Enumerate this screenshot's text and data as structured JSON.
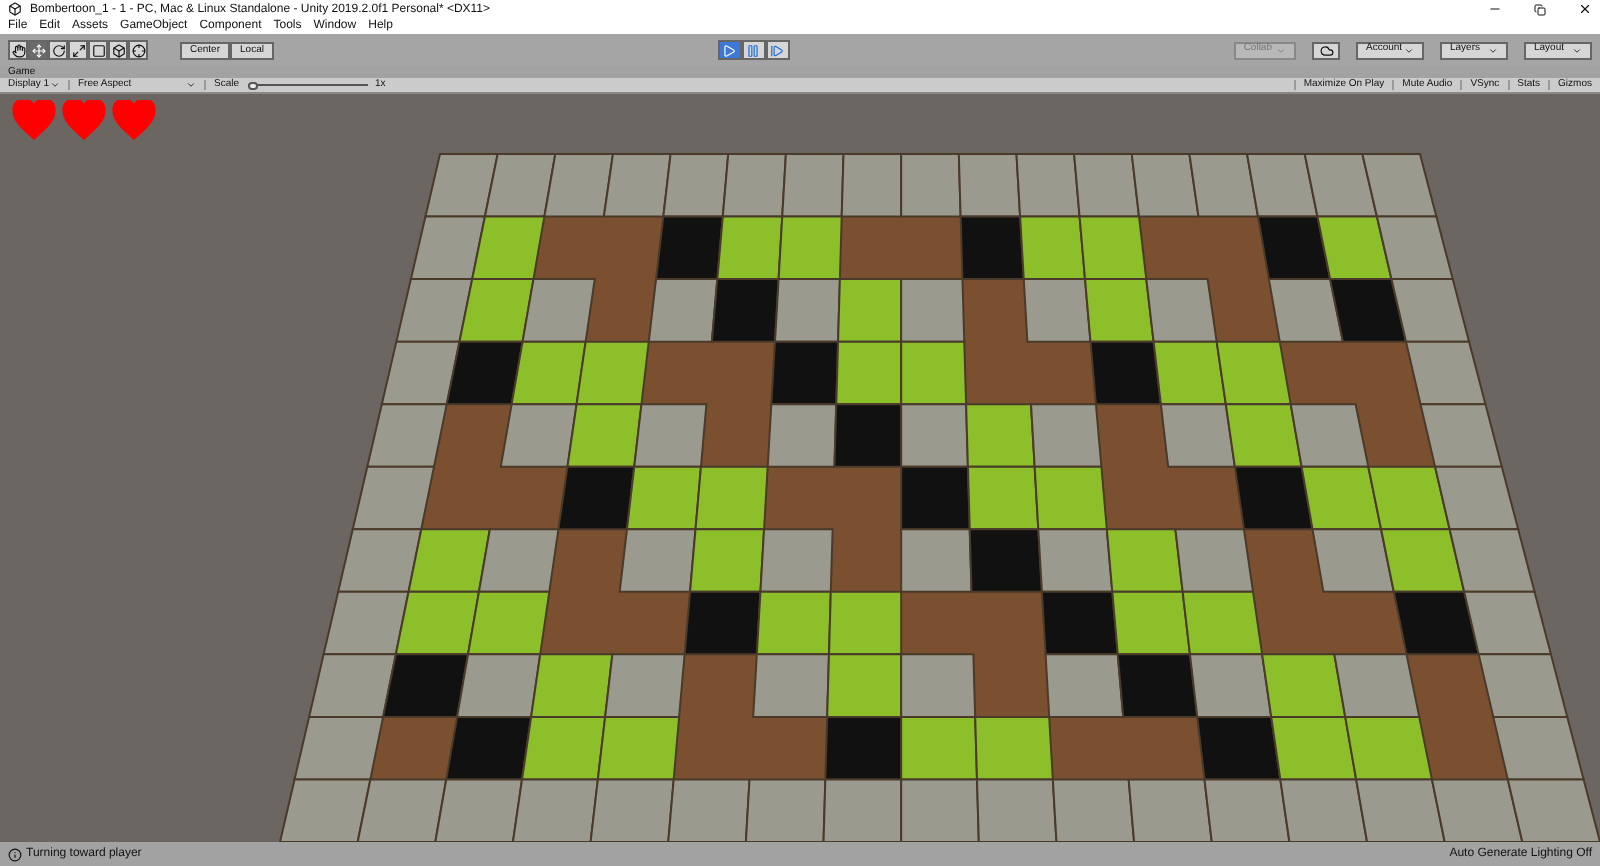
{
  "window": {
    "title": "Bombertoon_1 - 1 - PC, Mac & Linux Standalone - Unity 2019.2.0f1 Personal* <DX11>"
  },
  "menu": [
    "File",
    "Edit",
    "Assets",
    "GameObject",
    "Component",
    "Tools",
    "Window",
    "Help"
  ],
  "tools": [
    {
      "kind": "hand",
      "selected": false
    },
    {
      "kind": "move",
      "selected": true
    },
    {
      "kind": "rotate",
      "selected": false
    },
    {
      "kind": "scale",
      "selected": false
    },
    {
      "kind": "rect",
      "selected": false
    },
    {
      "kind": "transform",
      "selected": false
    },
    {
      "kind": "custom",
      "selected": false
    }
  ],
  "pivot_buttons": [
    "Center",
    "Local"
  ],
  "playback": [
    {
      "kind": "play",
      "selected": true
    },
    {
      "kind": "pause",
      "selected": false
    },
    {
      "kind": "step",
      "selected": false
    }
  ],
  "right_toolbar": {
    "collab": "Collab",
    "dropdowns": [
      "Account",
      "Layers",
      "Layout"
    ]
  },
  "game_tab": {
    "label": "Game"
  },
  "game_toolbar": {
    "display": "Display 1",
    "aspect": "Free Aspect",
    "scale_label": "Scale",
    "scale": {
      "level": 0.0
    },
    "scale_value": "1x",
    "toggles": [
      "Maximize On Play",
      "Mute Audio",
      "VSync",
      "Stats",
      "Gizmos"
    ]
  },
  "hearts": [
    {
      "filled": true
    },
    {
      "filled": true
    },
    {
      "filled": true
    }
  ],
  "status_bar": {
    "message": "Turning toward player",
    "lighting": "Auto Generate Lighting Off"
  }
}
